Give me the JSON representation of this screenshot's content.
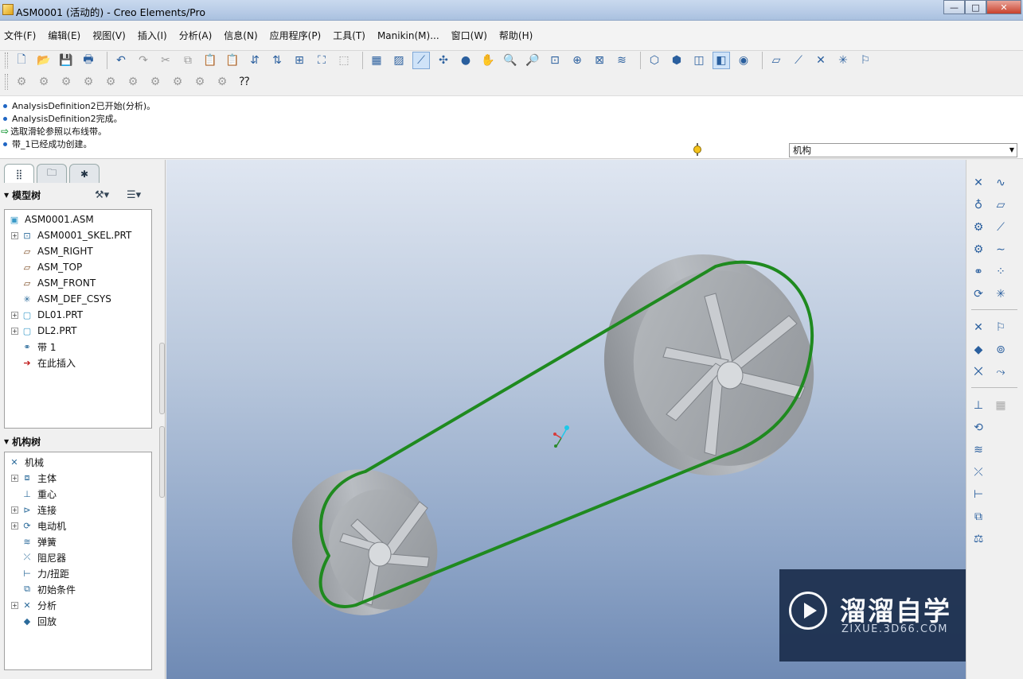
{
  "window": {
    "title": "ASM0001 (活动的) - Creo Elements/Pro",
    "minimize": "—",
    "maximize": "□",
    "close": "✕"
  },
  "menu": [
    "文件(F)",
    "编辑(E)",
    "视图(V)",
    "插入(I)",
    "分析(A)",
    "信息(N)",
    "应用程序(P)",
    "工具(T)",
    "Manikin(M)...",
    "窗口(W)",
    "帮助(H)"
  ],
  "toolbar_row1": [
    {
      "icon": "new-icon",
      "glyph": "🗋"
    },
    {
      "icon": "open-icon",
      "glyph": "📂"
    },
    {
      "icon": "save-icon",
      "glyph": "💾"
    },
    {
      "icon": "print-icon",
      "glyph": "🖶"
    },
    {
      "icon": "sep"
    },
    {
      "icon": "undo-icon",
      "glyph": "↶"
    },
    {
      "icon": "redo-icon",
      "glyph": "↷",
      "gray": true
    },
    {
      "icon": "cut-icon",
      "glyph": "✂",
      "gray": true
    },
    {
      "icon": "copy-icon",
      "glyph": "⧉",
      "gray": true
    },
    {
      "icon": "paste-icon",
      "glyph": "📋",
      "gray": true
    },
    {
      "icon": "paste-special-icon",
      "glyph": "📋",
      "gray": true
    },
    {
      "icon": "regenerate-icon",
      "glyph": "⇵"
    },
    {
      "icon": "regen-manager-icon",
      "glyph": "⇅"
    },
    {
      "icon": "find-icon",
      "glyph": "⊞"
    },
    {
      "icon": "binoculars-icon",
      "glyph": "⛶"
    },
    {
      "icon": "select-box-icon",
      "glyph": "⬚",
      "gray": true
    },
    {
      "icon": "sep"
    },
    {
      "icon": "model-tree-icon",
      "glyph": "▦"
    },
    {
      "icon": "plane-display-icon",
      "glyph": "▨"
    },
    {
      "icon": "axis-display-icon",
      "glyph": "⟋",
      "active": true
    },
    {
      "icon": "point-display-icon",
      "glyph": "✣"
    },
    {
      "icon": "shading-icon",
      "glyph": "●"
    },
    {
      "icon": "pan-icon",
      "glyph": "✋"
    },
    {
      "icon": "zoom-in-icon",
      "glyph": "🔍"
    },
    {
      "icon": "zoom-out-icon",
      "glyph": "🔎"
    },
    {
      "icon": "refit-icon",
      "glyph": "⊡"
    },
    {
      "icon": "orient-icon",
      "glyph": "⊕"
    },
    {
      "icon": "saved-views-icon",
      "glyph": "⊠"
    },
    {
      "icon": "layers-icon",
      "glyph": "≋"
    },
    {
      "icon": "sep"
    },
    {
      "icon": "wireframe-icon",
      "glyph": "⬡"
    },
    {
      "icon": "hidden-line-icon",
      "glyph": "⬢"
    },
    {
      "icon": "no-hidden-icon",
      "glyph": "◫"
    },
    {
      "icon": "shaded-icon",
      "glyph": "◧",
      "active": true
    },
    {
      "icon": "appearance-icon",
      "glyph": "◉"
    },
    {
      "icon": "sep"
    },
    {
      "icon": "datum-plane-icon",
      "glyph": "▱"
    },
    {
      "icon": "datum-axis-icon",
      "glyph": "⟋"
    },
    {
      "icon": "datum-point-icon",
      "glyph": "✕"
    },
    {
      "icon": "datum-csys-icon",
      "glyph": "✳"
    },
    {
      "icon": "annotation-icon",
      "glyph": "⚐"
    }
  ],
  "toolbar_row2": [
    "feature-icon-1",
    "feature-icon-2",
    "feature-icon-3",
    "feature-icon-4",
    "feature-icon-5",
    "feature-icon-6",
    "feature-icon-7",
    "feature-icon-8",
    "feature-icon-9",
    "feature-icon-10",
    "context-help-icon"
  ],
  "messages": [
    {
      "type": "info",
      "text": "AnalysisDefinition2已开始(分析)。"
    },
    {
      "type": "info",
      "text": "AnalysisDefinition2完成。"
    },
    {
      "type": "prompt",
      "text": "选取滑轮参照以布线带。"
    },
    {
      "type": "info",
      "text": "带_1已经成功创建。"
    }
  ],
  "filter": {
    "value": "机构"
  },
  "left_panel": {
    "model_tree_title": "模型树",
    "model_tree": [
      {
        "label": "ASM0001.ASM",
        "icon": "assembly-icon",
        "level": 0
      },
      {
        "label": "ASM0001_SKEL.PRT",
        "icon": "skeleton-part-icon",
        "level": 1,
        "expand": true
      },
      {
        "label": "ASM_RIGHT",
        "icon": "datum-plane-icon",
        "level": 1
      },
      {
        "label": "ASM_TOP",
        "icon": "datum-plane-icon",
        "level": 1
      },
      {
        "label": "ASM_FRONT",
        "icon": "datum-plane-icon",
        "level": 1
      },
      {
        "label": "ASM_DEF_CSYS",
        "icon": "csys-icon",
        "level": 1
      },
      {
        "label": "DL01.PRT",
        "icon": "part-icon",
        "level": 1,
        "expand": true
      },
      {
        "label": "DL2.PRT",
        "icon": "part-icon",
        "level": 1,
        "expand": true
      },
      {
        "label": "带 1",
        "icon": "belt-icon",
        "level": 1
      },
      {
        "label": "在此插入",
        "icon": "insert-here-icon",
        "level": 1
      }
    ],
    "mech_tree_title": "机构树",
    "mech_tree": [
      {
        "label": "机械",
        "icon": "mechanism-icon",
        "level": 0
      },
      {
        "label": "主体",
        "icon": "bodies-icon",
        "level": 1,
        "expand": true
      },
      {
        "label": "重心",
        "icon": "gravity-icon",
        "level": 1
      },
      {
        "label": "连接",
        "icon": "connections-icon",
        "level": 1,
        "expand": true
      },
      {
        "label": "电动机",
        "icon": "motor-icon",
        "level": 1,
        "expand": true
      },
      {
        "label": "弹簧",
        "icon": "spring-icon",
        "level": 1
      },
      {
        "label": "阻尼器",
        "icon": "damper-icon",
        "level": 1
      },
      {
        "label": "力/扭距",
        "icon": "force-icon",
        "level": 1
      },
      {
        "label": "初始条件",
        "icon": "initial-condition-icon",
        "level": 1
      },
      {
        "label": "分析",
        "icon": "analysis-icon",
        "level": 1,
        "expand": true
      },
      {
        "label": "回放",
        "icon": "playback-icon",
        "level": 1
      }
    ]
  },
  "watermark": {
    "name": "溜溜自学",
    "url": "ZIXUE.3D66.COM"
  },
  "colors": {
    "belt": "#1f8a1f",
    "pulley": "#a9adb2",
    "viewport_top": "#dfe6f1",
    "viewport_bottom": "#6f8ab4"
  }
}
